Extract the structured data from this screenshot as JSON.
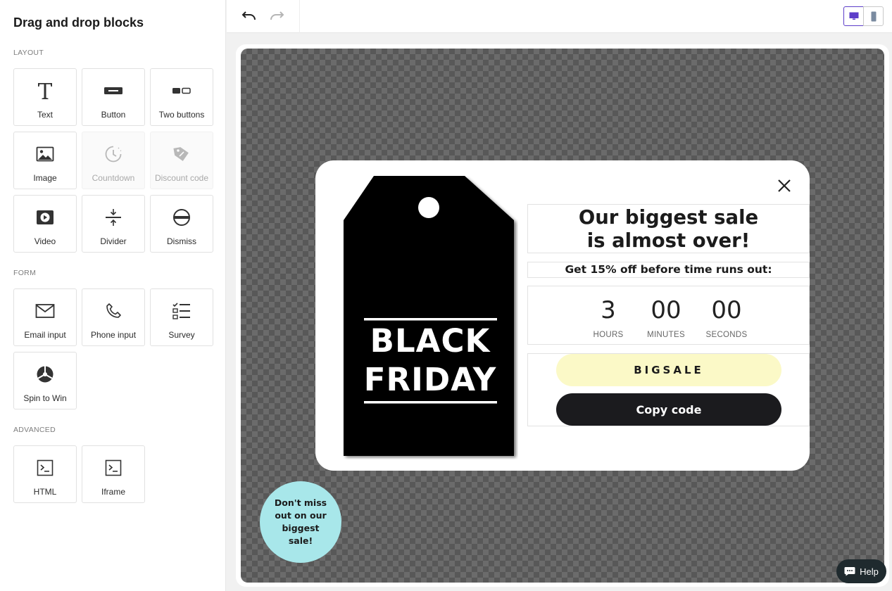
{
  "sidebar": {
    "title": "Drag and drop blocks",
    "sections": {
      "layout": "LAYOUT",
      "form": "FORM",
      "advanced": "ADVANCED"
    },
    "blocks": {
      "text": "Text",
      "button": "Button",
      "two_buttons": "Two buttons",
      "image": "Image",
      "countdown": "Countdown",
      "discount_code": "Discount code",
      "video": "Video",
      "divider": "Divider",
      "dismiss": "Dismiss",
      "email_input": "Email input",
      "phone_input": "Phone input",
      "survey": "Survey",
      "spin_to_win": "Spin to Win",
      "html": "HTML",
      "iframe": "Iframe"
    }
  },
  "toolbar": {
    "undo_icon": "undo-icon",
    "redo_icon": "redo-icon",
    "devices": [
      "desktop",
      "mobile"
    ],
    "active_device": "desktop",
    "accent": "#5c3dc9"
  },
  "popup": {
    "tag_line1": "BLACK",
    "tag_line2": "FRIDAY",
    "headline_line1": "Our biggest sale",
    "headline_line2": "is almost over!",
    "subheadline": "Get 15% off before time runs out:",
    "countdown": [
      {
        "value": "3",
        "label": "HOURS"
      },
      {
        "value": "00",
        "label": "MINUTES"
      },
      {
        "value": "00",
        "label": "SECONDS"
      }
    ],
    "code": "BIGSALE",
    "copy_button": "Copy code",
    "code_bg": "#fbf9c7"
  },
  "teaser": {
    "text": "Don't miss out on our biggest sale!",
    "bg": "#a8e7ea"
  },
  "help": {
    "label": "Help"
  }
}
